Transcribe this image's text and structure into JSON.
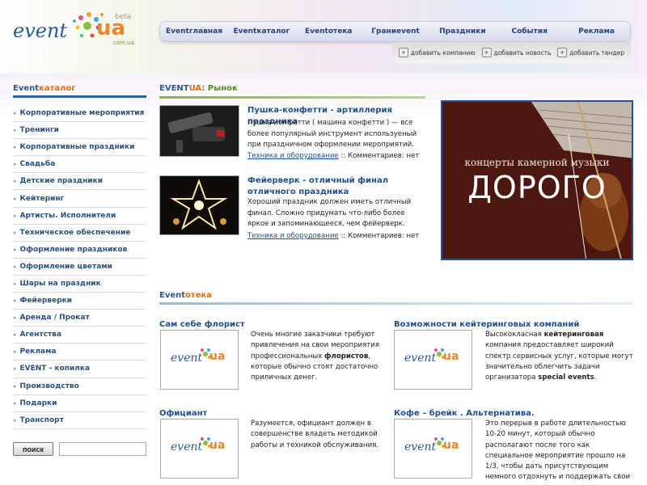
{
  "logo": {
    "event": "event",
    "ua": "ua",
    "beta": "beta",
    "domain": "com.ua"
  },
  "nav": {
    "items": [
      "Eventглавная",
      "Eventкаталог",
      "Eventотека",
      "Граниevent",
      "Праздники",
      "События",
      "Реклама"
    ]
  },
  "subnav": {
    "items": [
      {
        "label": "добавить компанию",
        "icon": "add-company-icon"
      },
      {
        "label": "добавить новость",
        "icon": "add-news-icon"
      },
      {
        "label": "добавить тендер",
        "icon": "add-tender-icon"
      }
    ]
  },
  "sidebar": {
    "title_a": "Event",
    "title_b": "каталог",
    "items": [
      "Корпоративные мероприятия",
      "Тренинги",
      "Корпоративные праздники",
      "Свадьба",
      "Детские праздники",
      "Кейтеринг",
      "Артисты. Исполнители",
      "Техническое обеспечение",
      "Оформление праздников",
      "Оформление цветами",
      "Шары на праздник",
      "Фейерверки",
      "Аренда / Прокат",
      "Агентства",
      "Реклама",
      "EVENT - копилка",
      "Производство",
      "Подарки",
      "Транспорт"
    ],
    "search_label": "поиск",
    "search_value": ""
  },
  "market": {
    "heading_a": "EVENT",
    "heading_b": "UA",
    "heading_c": ": Рынок",
    "news": [
      {
        "title": "Пушка-конфетти - артиллерия праздника",
        "text": "Пушка-конфетти ( машина конфетти ) — все более популярный инструмент используеный при праздничном оформлении мероприятий.",
        "link": "Техника и оборудование",
        "meta": " :: Комментариев: нет"
      },
      {
        "title": "Фейерверк - отличный финал отличного праздника",
        "text": "Хороший праздник должен иметь отличный финал. Сложно придумать что-либо более яркое и запоминающееся, чем фейерверк.",
        "link": "Техника и оборудование",
        "meta": " :: Комментариев: нет"
      }
    ]
  },
  "banner": {
    "line1": "концерты камерной музыки",
    "line2": "ДОРОГО"
  },
  "eventoteka": {
    "heading_a": "Event",
    "heading_b": "отека",
    "cards": [
      {
        "title": "Сам себе флорист",
        "t1": "Очень многие заказчики требуют привлечения на свои мероприятия профессиональных ",
        "b1": "флористов",
        "t2": ", которые обычно стоят достаточно приличных денег."
      },
      {
        "title": "Возможности кейтеринговых компаний",
        "t1": "Высококласная ",
        "b1": "кейтеринговая",
        "t2": " компания предоставляет широкий спектр сервисных услуг, которые могут значительно облегчить задачи организатора ",
        "b2": "special events",
        "t3": "."
      },
      {
        "title": "Официант",
        "t1": "Разумеется, официант должен в совершенстве владеть методикой работы и техникой обслуживания."
      },
      {
        "title": "Кофе – брейк . Альтернатива.",
        "t1": "Это перерыв в работе длительностью 10-20 минут, который обычно располагают после того как специальное мероприятие прошло на 1/3, чтобы дать присутствующим немного отдохнуть и поддержать свои силы напитками и легкими закусками."
      }
    ]
  },
  "colors": {
    "brand_blue": "#2a5a93",
    "accent_orange": "#e36b12",
    "green": "#5b8a1e",
    "link_blue": "#1f4f8f",
    "banner_bg": "#4d1711"
  }
}
